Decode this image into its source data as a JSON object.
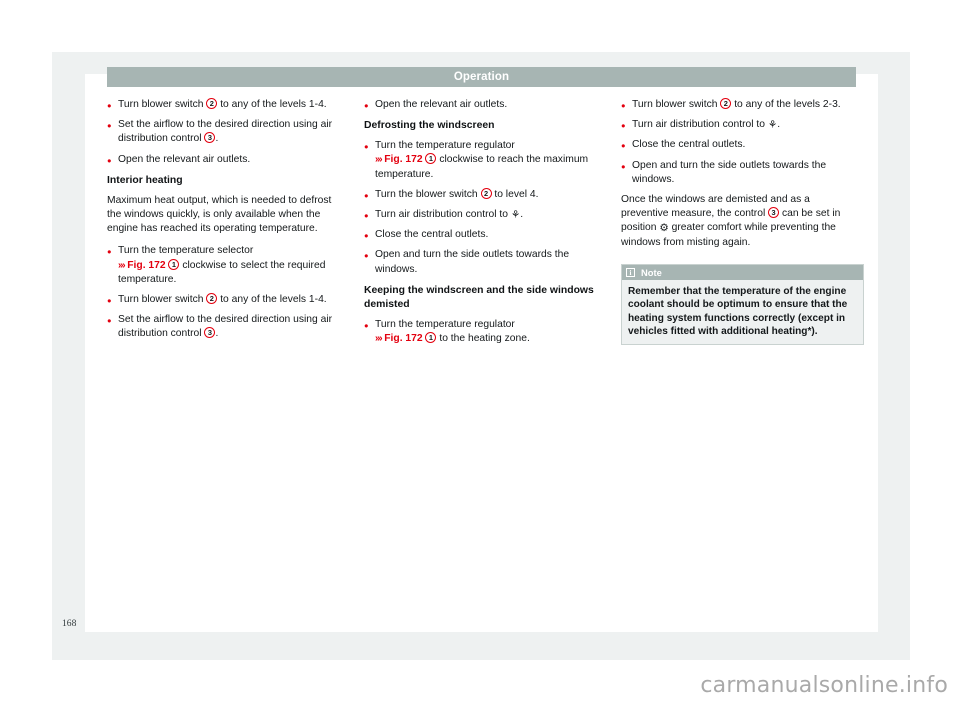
{
  "document": {
    "chapter_title": "Operation",
    "page_number": "168",
    "watermark": "carmanualsonline.info"
  },
  "columns": [
    {
      "id": "left",
      "blocks": [
        {
          "type": "bullet",
          "id": "blower-1-4",
          "text_before": "Turn blower switch ",
          "callout": "2",
          "text_after": " to any of the levels 1-4."
        },
        {
          "type": "bullet",
          "id": "airflow-direction",
          "text_before": "Set the airflow to the desired direction using air distribution control ",
          "callout": "3",
          "text_after": "."
        },
        {
          "type": "bullet",
          "id": "open-outlets",
          "text_before": "Open the relevant air outlets.",
          "callout": "",
          "text_after": ""
        },
        {
          "type": "subhead",
          "id": "interior-heating",
          "text": "Interior heating"
        },
        {
          "type": "para",
          "id": "max-heat-output",
          "text": "Maximum heat output, which is needed to defrost the windows quickly, is only available when the engine has reached its operating temperature."
        },
        {
          "type": "bullet-xref",
          "id": "temp-selector",
          "lead": "Turn the temperature selector",
          "chevron": "›››",
          "xref": "Fig. 172",
          "callout": "1",
          "text_after": " clockwise to select the required temperature."
        },
        {
          "type": "bullet",
          "id": "blower-1-4-b",
          "text_before": "Turn blower switch ",
          "callout": "2",
          "text_after": " to any of the levels 1-4."
        },
        {
          "type": "bullet",
          "id": "airflow-direction-b",
          "text_before": "Set the airflow to the desired direction using air distribution control ",
          "callout": "3",
          "text_after": "."
        }
      ]
    },
    {
      "id": "middle",
      "blocks": [
        {
          "type": "bullet",
          "id": "open-outlets-m",
          "text_before": "Open the relevant air outlets.",
          "callout": "",
          "text_after": ""
        },
        {
          "type": "subhead",
          "id": "defrosting-windscreen",
          "text": "Defrosting the windscreen"
        },
        {
          "type": "bullet-xref",
          "id": "temp-regulator-max",
          "lead": "Turn the temperature regulator",
          "chevron": "›››",
          "xref": "Fig. 172",
          "callout": "1",
          "text_after": " clockwise to reach the maximum temperature."
        },
        {
          "type": "bullet",
          "id": "blower-level-4",
          "text_before": "Turn the blower switch ",
          "callout": "2",
          "text_after": " to level 4."
        },
        {
          "type": "bullet-glyph",
          "id": "air-dist-defrost",
          "text_before": "Turn air distribution control to ",
          "glyph": "defrost-windscreen-symbol",
          "text_after": "."
        },
        {
          "type": "bullet",
          "id": "close-central-outlets",
          "text_before": "Close the central outlets.",
          "callout": "",
          "text_after": ""
        },
        {
          "type": "bullet",
          "id": "side-outlets-windows",
          "text_before": "Open and turn the side outlets towards the windows.",
          "callout": "",
          "text_after": ""
        },
        {
          "type": "subhead",
          "id": "keeping-demisted",
          "text": "Keeping the windscreen and the side windows demisted"
        },
        {
          "type": "bullet-xref",
          "id": "temp-regulator-heating",
          "lead": "Turn the temperature regulator",
          "chevron": "›››",
          "xref": "Fig. 172",
          "callout": "1",
          "text_after": " to the heating zone."
        }
      ]
    },
    {
      "id": "right",
      "blocks": [
        {
          "type": "bullet",
          "id": "blower-2-3",
          "text_before": "Turn blower switch ",
          "callout": "2",
          "text_after": " to any of the levels 2-3."
        },
        {
          "type": "bullet-glyph",
          "id": "air-dist-defrost-r",
          "text_before": "Turn air distribution control to ",
          "glyph": "defrost-windscreen-symbol",
          "text_after": "."
        },
        {
          "type": "bullet",
          "id": "close-central-outlets-r",
          "text_before": "Close the central outlets.",
          "callout": "",
          "text_after": ""
        },
        {
          "type": "bullet",
          "id": "side-outlets-windows-r",
          "text_before": "Open and turn the side outlets towards the windows.",
          "callout": "",
          "text_after": ""
        },
        {
          "type": "para-callout",
          "id": "preventive-measure",
          "text_before": "Once the windows are demisted and as a preventive measure, the control ",
          "callout": "3",
          "text_mid": " can be set in position ",
          "glyph": "demist-comfort-symbol",
          "text_after": " greater comfort while preventing the windows from misting again."
        }
      ],
      "note": {
        "title": "Note",
        "icon": "info-icon",
        "body": "Remember that the temperature of the engine coolant should be optimum to ensure that the heating system functions correctly (except in vehicles fitted with additional heating*)."
      }
    }
  ],
  "colors": {
    "accent_red": "#e3000f",
    "chapter_bar": "#a7b5b3",
    "note_bg": "#eef1f1",
    "plate_bg": "#eef1f1",
    "text": "#14181a"
  }
}
